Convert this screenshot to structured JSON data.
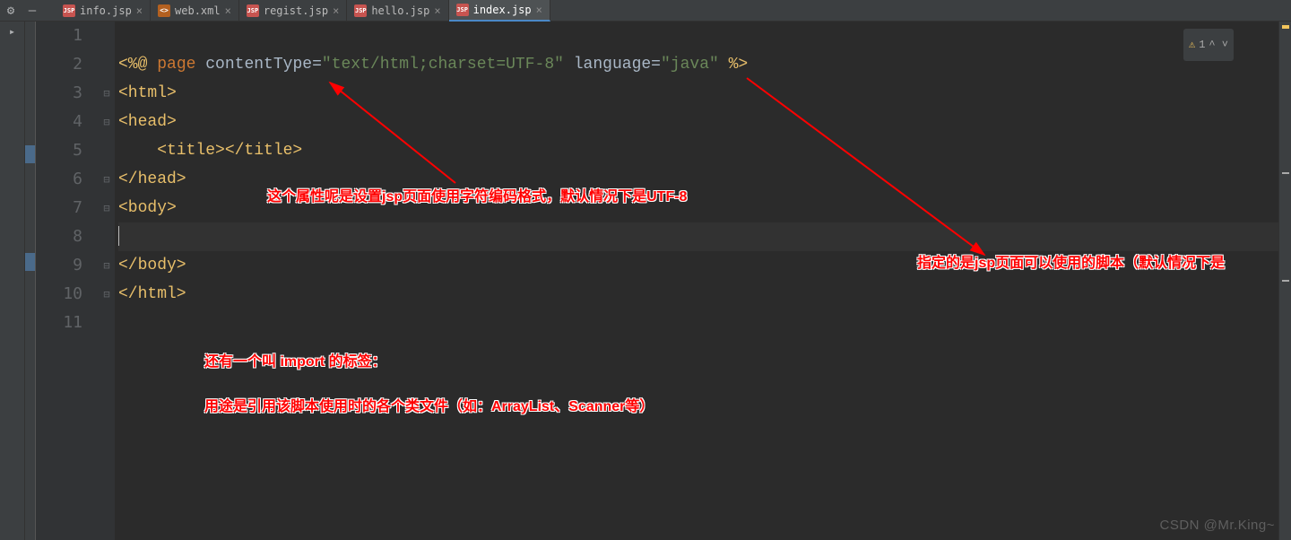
{
  "toolbar": {
    "gear": "⚙",
    "dash": "—"
  },
  "tabs": [
    {
      "icon": "JSP",
      "label": "info.jsp",
      "active": false
    },
    {
      "icon": "XML",
      "label": "web.xml",
      "active": false
    },
    {
      "icon": "JSP",
      "label": "regist.jsp",
      "active": false
    },
    {
      "icon": "JSP",
      "label": "hello.jsp",
      "active": false
    },
    {
      "icon": "JSP",
      "label": "index.jsp",
      "active": true
    }
  ],
  "lineNumbers": [
    "1",
    "2",
    "3",
    "4",
    "5",
    "6",
    "7",
    "8",
    "9",
    "10",
    "11"
  ],
  "folds": [
    "",
    "",
    "⊟",
    "⊟",
    "",
    "⊟",
    "⊟",
    "",
    "⊟",
    "⊟",
    ""
  ],
  "code": {
    "l2": {
      "open": "<%@ ",
      "page": "page",
      "contentType": " contentType",
      "eq1": "=",
      "q1": "\"",
      "ct": "text/html;charset=UTF-8",
      "q2": "\"",
      "lang": " language",
      "eq2": "=",
      "q3": "\"",
      "java": "java",
      "q4": "\"",
      "close": " %>"
    },
    "l3": "<html>",
    "l4": "<head>",
    "l5": "    <title></title>",
    "l6": "</head>",
    "l7": "<body>",
    "l9": "</body>",
    "l10": "</html>"
  },
  "annotations": {
    "a1": "这个属性呢是设置jsp页面使用字符编码格式，默认情况下是UTF-8",
    "a2": "指定的是jsp页面可以使用的脚本（默认情况下是",
    "a3": "还有一个叫 import  的标签：",
    "a4": "用途是引用该脚本使用时的各个类文件（如：ArrayList、Scanner等）"
  },
  "warn": {
    "count": "1",
    "arrows": "^ ˅"
  },
  "watermark": "CSDN @Mr.King~"
}
